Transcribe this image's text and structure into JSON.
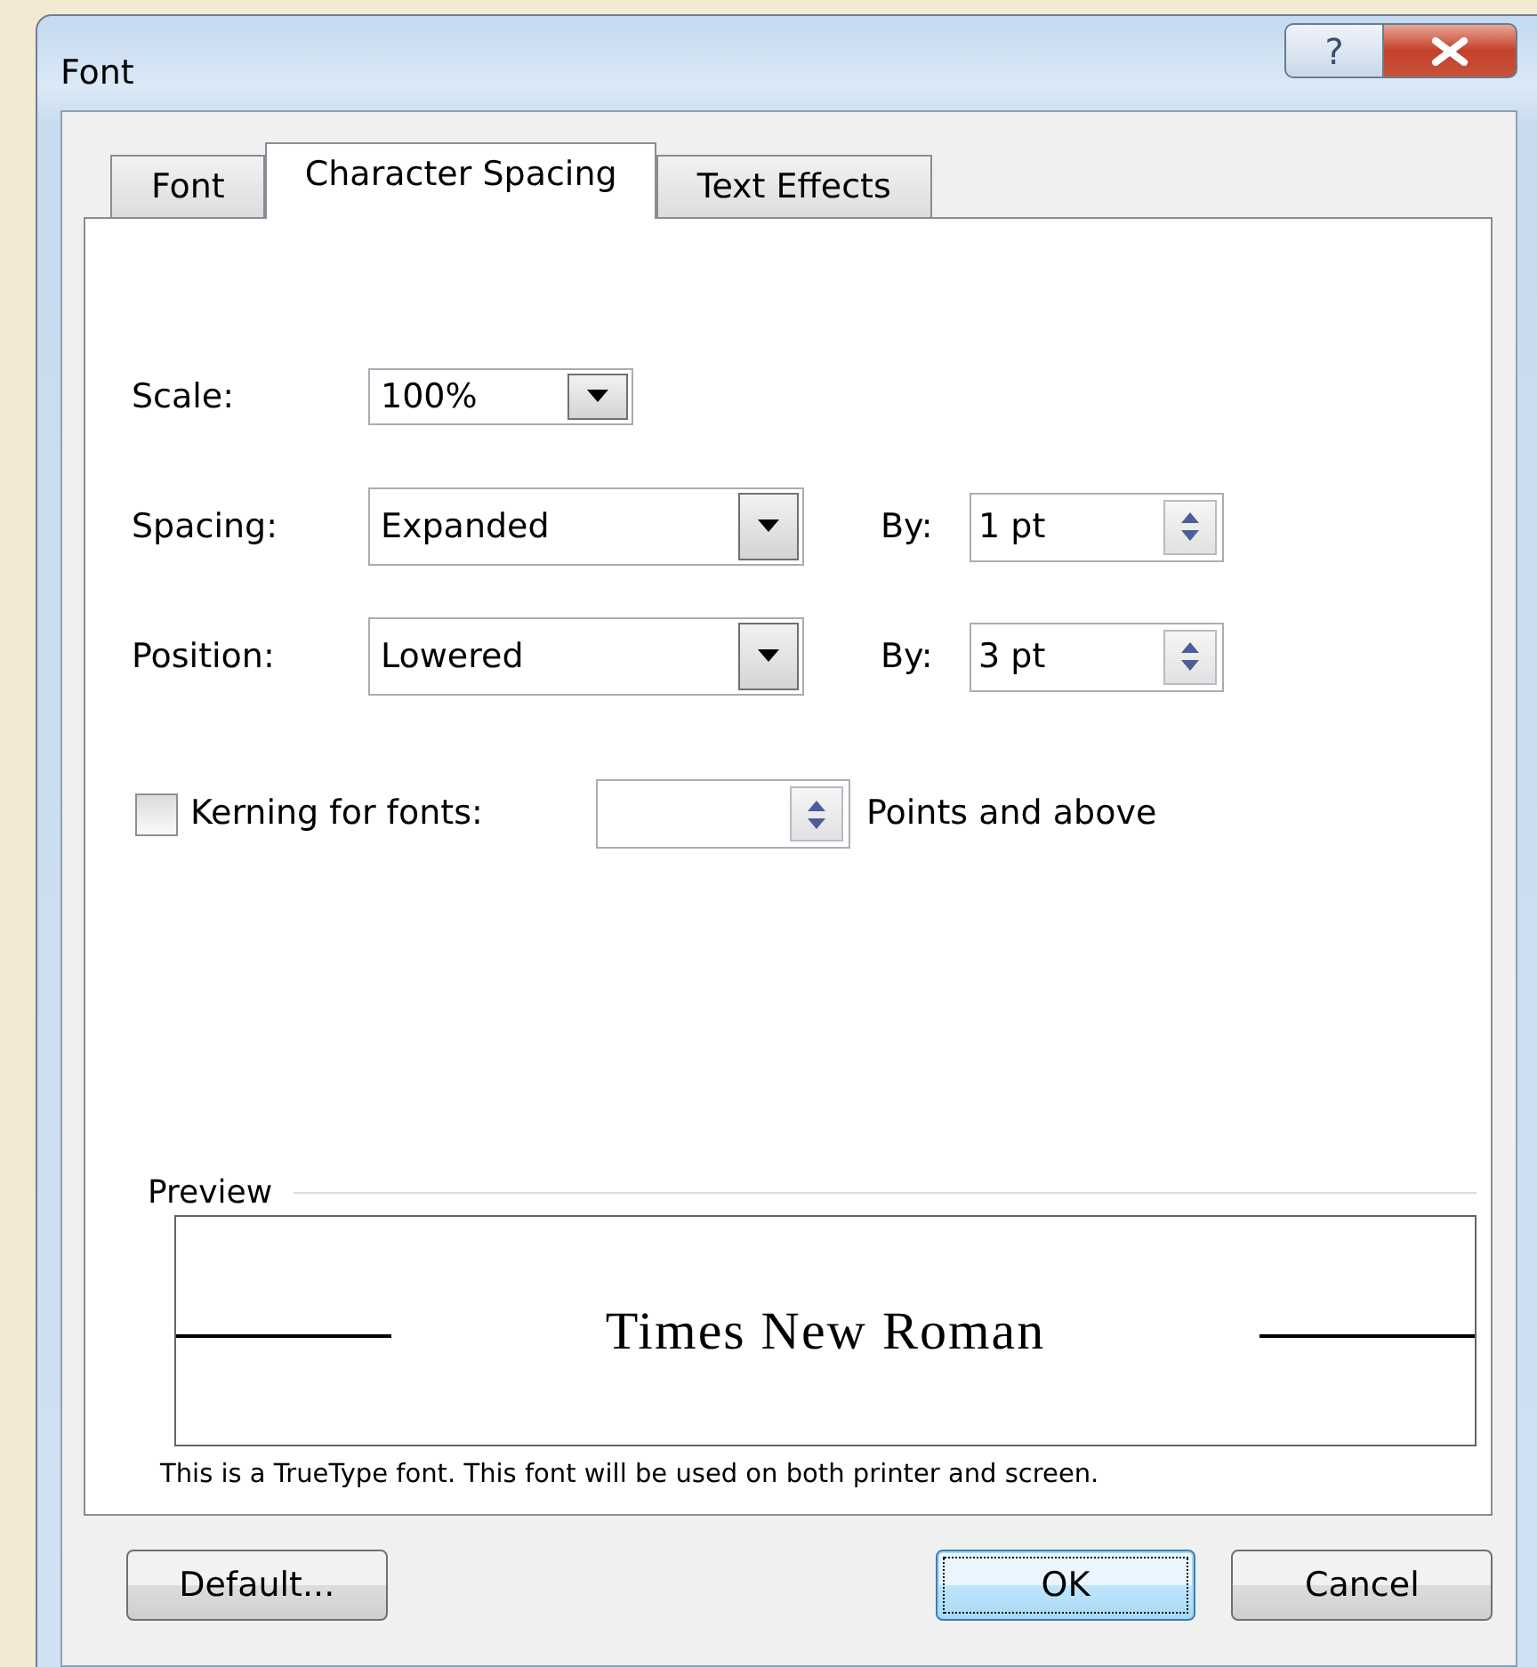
{
  "window": {
    "title": "Font",
    "help_button": "?"
  },
  "tabs": [
    {
      "label": "Font",
      "selected": false
    },
    {
      "label": "Character Spacing",
      "selected": true
    },
    {
      "label": "Text Effects",
      "selected": false
    }
  ],
  "fields": [
    {
      "label": "Scale:",
      "value": "100%",
      "kind": "dropdown"
    },
    {
      "label": "Spacing:",
      "value": "Expanded",
      "kind": "dropdown",
      "by_label": "By:",
      "by_value": "1 pt"
    },
    {
      "label": "Position:",
      "value": "Lowered",
      "kind": "dropdown",
      "by_label": "By:",
      "by_value": "3 pt"
    }
  ],
  "kerning": {
    "label": "Kerning for fonts:",
    "checked": false,
    "suffix": "Points and above"
  },
  "preview": {
    "legend": "Preview",
    "sample": "Times New Roman",
    "note": "This is a TrueType font. This font will be used on both printer and screen."
  },
  "buttons": [
    {
      "label": "Default...",
      "default": false
    },
    {
      "label": "OK",
      "default": true
    },
    {
      "label": "Cancel",
      "default": false
    }
  ]
}
